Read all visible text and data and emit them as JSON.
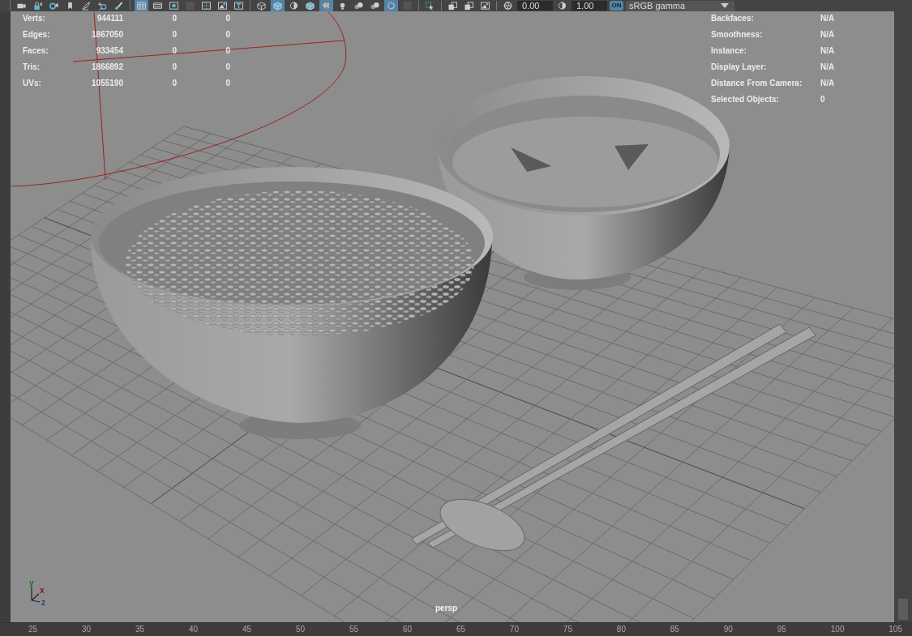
{
  "toolbar": {
    "items": [
      {
        "kind": "sep"
      },
      {
        "kind": "camera",
        "selected": false
      },
      {
        "kind": "lock",
        "selected": false
      },
      {
        "kind": "gear",
        "selected": false
      },
      {
        "kind": "bookmark",
        "selected": false
      },
      {
        "kind": "pen",
        "selected": false
      },
      {
        "kind": "magnifier",
        "selected": false
      },
      {
        "kind": "brush",
        "selected": false
      },
      {
        "kind": "sep"
      },
      {
        "kind": "grid",
        "selected": true
      },
      {
        "kind": "film",
        "selected": false
      },
      {
        "kind": "dot",
        "selected": false
      },
      {
        "kind": "dark",
        "selected": false
      },
      {
        "kind": "cross",
        "selected": false
      },
      {
        "kind": "image",
        "selected": false
      },
      {
        "kind": "letter",
        "selected": false
      },
      {
        "kind": "sep"
      },
      {
        "kind": "cube",
        "selected": false
      },
      {
        "kind": "cubefill",
        "selected": true
      },
      {
        "kind": "halfsphere",
        "selected": false
      },
      {
        "kind": "cubefill",
        "selected": false
      },
      {
        "kind": "checker",
        "selected": true
      },
      {
        "kind": "bulb",
        "selected": false
      },
      {
        "kind": "spheres",
        "selected": false
      },
      {
        "kind": "spheres",
        "selected": false
      },
      {
        "kind": "ring",
        "selected": true
      },
      {
        "kind": "dark",
        "selected": false
      },
      {
        "kind": "sep"
      },
      {
        "kind": "select",
        "selected": false
      },
      {
        "kind": "sep"
      },
      {
        "kind": "layers",
        "selected": false
      },
      {
        "kind": "layers",
        "selected": false
      },
      {
        "kind": "image",
        "selected": false
      },
      {
        "kind": "sep"
      },
      {
        "kind": "aperture",
        "selected": false
      },
      {
        "kind": "field",
        "value": "0.00"
      },
      {
        "kind": "halfsphere",
        "selected": false
      },
      {
        "kind": "field",
        "value": "1.00"
      },
      {
        "kind": "badge",
        "text": "ON"
      },
      {
        "kind": "dropdown",
        "value": "sRGB gamma"
      }
    ]
  },
  "hud_left": [
    {
      "label": "Verts:",
      "value": "944111",
      "column_3": "0",
      "column_4": "0"
    },
    {
      "label": "Edges:",
      "value": "1867050",
      "column_3": "0",
      "column_4": "0"
    },
    {
      "label": "Faces:",
      "value": "933454",
      "column_3": "0",
      "column_4": "0"
    },
    {
      "label": "Tris:",
      "value": "1866892",
      "column_3": "0",
      "column_4": "0"
    },
    {
      "label": "UVs:",
      "value": "1055190",
      "column_3": "0",
      "column_4": "0"
    }
  ],
  "hud_right": [
    {
      "label": "Backfaces:",
      "value": "N/A"
    },
    {
      "label": "Smoothness:",
      "value": "N/A"
    },
    {
      "label": "Instance:",
      "value": "N/A"
    },
    {
      "label": "Display Layer:",
      "value": "N/A"
    },
    {
      "label": "Distance From Camera:",
      "value": "N/A"
    },
    {
      "label": "Selected Objects:",
      "value": "0"
    }
  ],
  "axis_labels": [
    "y",
    "x",
    "z"
  ],
  "camera_label": "persp",
  "timeline": [
    "25",
    "30",
    "35",
    "40",
    "45",
    "50",
    "55",
    "60",
    "65",
    "70",
    "75",
    "80",
    "85",
    "90",
    "95",
    "100",
    "105"
  ]
}
